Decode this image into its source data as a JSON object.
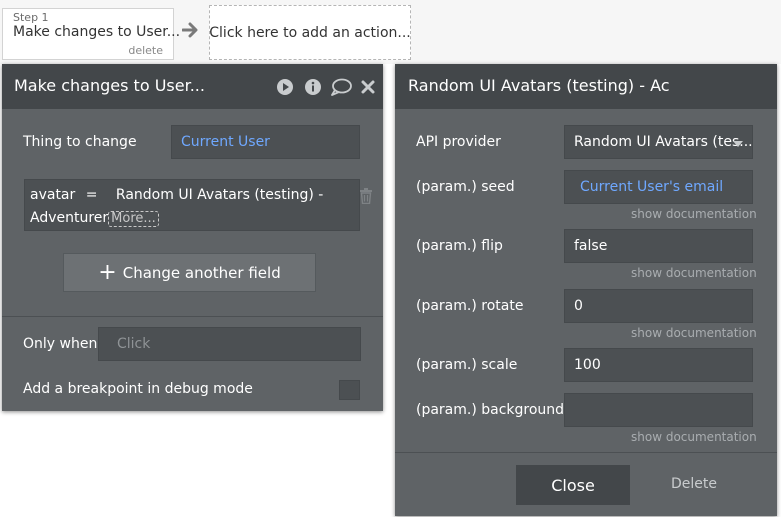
{
  "workflow": {
    "step": {
      "number_label": "Step 1",
      "title": "Make changes to User...",
      "delete_label": "delete"
    },
    "add_action_label": "Click here to add an action..."
  },
  "left_panel": {
    "title": "Make changes to User...",
    "thing_to_change": {
      "label": "Thing to change",
      "value": "Current User"
    },
    "field_change": {
      "field": "avatar",
      "operator": "=",
      "expression_line1": "Random UI Avatars (testing) -",
      "expression_line2": "Adventurer",
      "more_label": "More..."
    },
    "change_another_label": "Change another field",
    "only_when": {
      "label": "Only when",
      "placeholder": "Click"
    },
    "breakpoint_label": "Add a breakpoint in debug mode",
    "icons": [
      "play-icon",
      "info-icon",
      "comment-icon",
      "close-icon",
      "trash-icon",
      "plus-icon"
    ]
  },
  "right_panel": {
    "title": "Random UI Avatars (testing) - Ac",
    "api_provider": {
      "label": "API provider",
      "value": "Random UI Avatars (tes..."
    },
    "params": [
      {
        "label": "(param.) seed",
        "value": "Current User's email",
        "is_expression": true,
        "doc": "show documentation"
      },
      {
        "label": "(param.) flip",
        "value": "false",
        "is_expression": false,
        "doc": "show documentation"
      },
      {
        "label": "(param.) rotate",
        "value": "0",
        "is_expression": false,
        "doc": "show documentation"
      },
      {
        "label": "(param.) scale",
        "value": "100",
        "is_expression": false,
        "doc": ""
      },
      {
        "label": "(param.) backgroundC",
        "value": "",
        "is_expression": false,
        "doc": "show documentation"
      }
    ],
    "close_label": "Close",
    "delete_label": "Delete"
  },
  "colors": {
    "panel": "#5f6366",
    "header": "#43474a",
    "field": "#4c5053",
    "expression_text": "#6fa8ff"
  }
}
